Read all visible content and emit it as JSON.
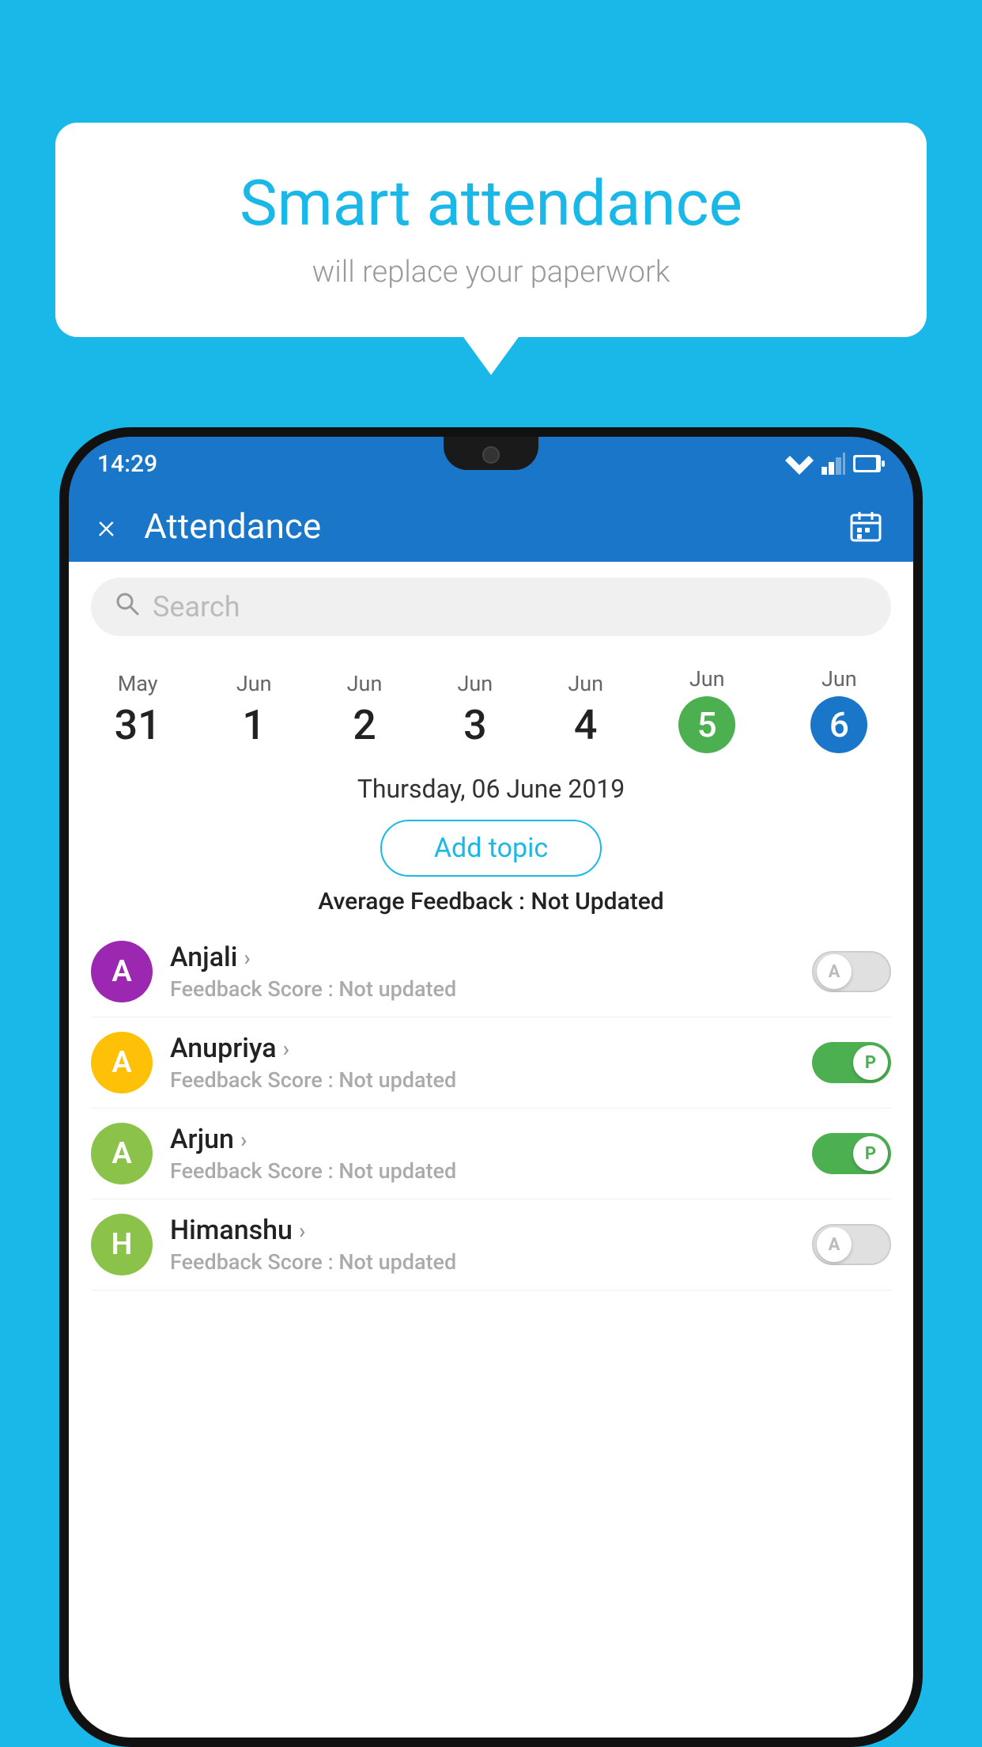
{
  "background": {
    "color": "#1ab8e8"
  },
  "bubble": {
    "title": "Smart attendance",
    "subtitle": "will replace your paperwork"
  },
  "status_bar": {
    "time": "14:29"
  },
  "header": {
    "title": "Attendance",
    "close_label": "×"
  },
  "search": {
    "placeholder": "Search"
  },
  "dates": [
    {
      "month": "May",
      "day": "31",
      "active": false
    },
    {
      "month": "Jun",
      "day": "1",
      "active": false
    },
    {
      "month": "Jun",
      "day": "2",
      "active": false
    },
    {
      "month": "Jun",
      "day": "3",
      "active": false
    },
    {
      "month": "Jun",
      "day": "4",
      "active": false
    },
    {
      "month": "Jun",
      "day": "5",
      "active": "green"
    },
    {
      "month": "Jun",
      "day": "6",
      "active": "blue"
    }
  ],
  "selected_date": "Thursday, 06 June 2019",
  "add_topic_label": "Add topic",
  "avg_feedback_label": "Average Feedback :",
  "avg_feedback_value": "Not Updated",
  "students": [
    {
      "name": "Anjali",
      "avatar_letter": "A",
      "avatar_color": "#9c27b0",
      "feedback_label": "Feedback Score :",
      "feedback_value": "Not updated",
      "toggle_state": "off",
      "toggle_letter": "A"
    },
    {
      "name": "Anupriya",
      "avatar_letter": "A",
      "avatar_color": "#ffc107",
      "feedback_label": "Feedback Score :",
      "feedback_value": "Not updated",
      "toggle_state": "on",
      "toggle_letter": "P"
    },
    {
      "name": "Arjun",
      "avatar_letter": "A",
      "avatar_color": "#8bc34a",
      "feedback_label": "Feedback Score :",
      "feedback_value": "Not updated",
      "toggle_state": "on",
      "toggle_letter": "P"
    },
    {
      "name": "Himanshu",
      "avatar_letter": "H",
      "avatar_color": "#8bc34a",
      "feedback_label": "Feedback Score :",
      "feedback_value": "Not updated",
      "toggle_state": "off",
      "toggle_letter": "A"
    }
  ]
}
